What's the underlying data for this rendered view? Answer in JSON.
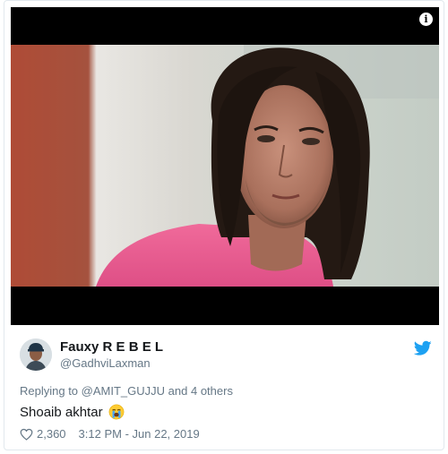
{
  "tweet": {
    "author_name": "Fauxy R E B E L",
    "author_handle": "@GadhviLaxman",
    "reply_prefix": "Replying to",
    "reply_to": "@AMIT_GUJJU",
    "reply_suffix": "and 4 others",
    "text": "Shoaib akhtar",
    "likes": "2,360",
    "timestamp": "3:12 PM - Jun 22, 2019"
  },
  "icons": {
    "media_info": "info-icon",
    "brand": "twitter-bird-icon",
    "emoji": "loudly-crying-face-icon",
    "like": "heart-icon"
  },
  "colors": {
    "twitter_blue": "#1da1f2",
    "text_primary": "#14171a",
    "text_secondary": "#657786",
    "border": "#e1e8ed"
  }
}
